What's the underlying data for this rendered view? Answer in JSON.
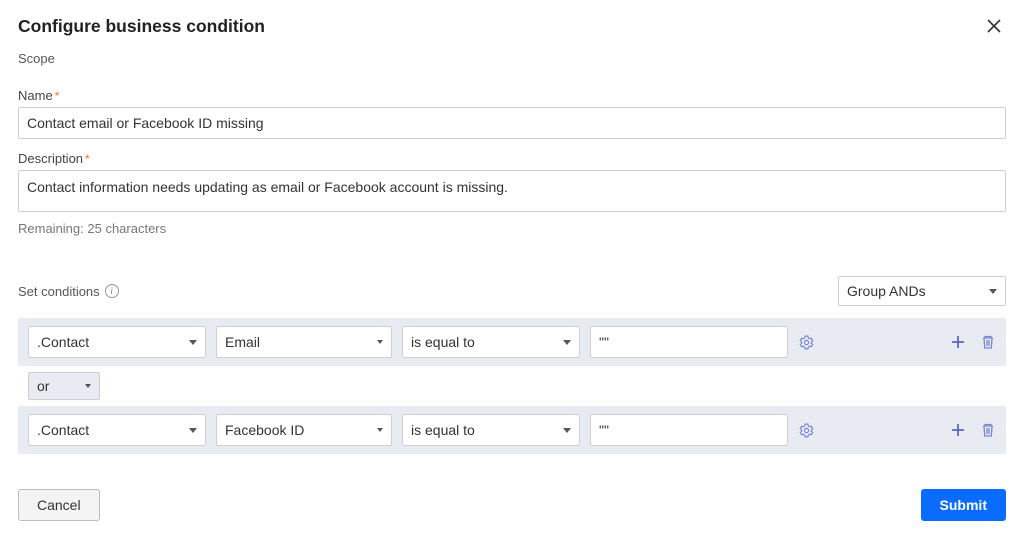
{
  "header": {
    "title": "Configure business condition",
    "scope_label": "Scope"
  },
  "form": {
    "name_label": "Name",
    "name_value": "Contact email or Facebook ID missing",
    "description_label": "Description",
    "description_value": "Contact information needs updating as email or Facebook account is missing.",
    "remaining_text": "Remaining: 25 characters"
  },
  "conditions": {
    "set_label": "Set conditions",
    "group_mode": "Group ANDs",
    "rows": [
      {
        "context": ".Contact",
        "field": "Email",
        "op": "is equal to",
        "value": "\"\""
      },
      {
        "context": ".Contact",
        "field": "Facebook ID",
        "op": "is equal to",
        "value": "\"\""
      }
    ],
    "connector": "or"
  },
  "footer": {
    "cancel": "Cancel",
    "submit": "Submit"
  },
  "icons": {
    "close": "close-icon",
    "info": "info-icon",
    "gear": "gear-icon",
    "plus": "plus-icon",
    "trash": "trash-icon",
    "caret": "caret-down-icon"
  },
  "colors": {
    "accent": "#0a6cff",
    "icon_accent": "#5c6bc0",
    "panel_bg": "#e9ebf2"
  }
}
